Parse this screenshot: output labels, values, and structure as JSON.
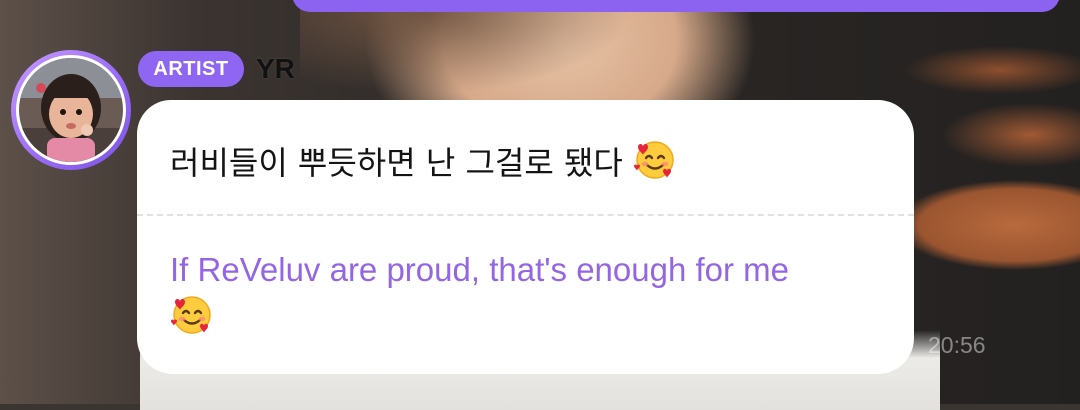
{
  "message": {
    "badge": "ARTIST",
    "sender": "YR",
    "avatar_icon": "profile-photo",
    "original_text": "러비들이 뿌듯하면 난 그걸로 됐다",
    "translated_text": "If ReVeluv are proud, that's enough for me",
    "emoji_icon": "smiling-face-with-hearts-emoji",
    "timestamp": "20:56"
  },
  "colors": {
    "accent": "#8e66f2",
    "translation": "#9466e4",
    "bubble": "#ffffff"
  }
}
